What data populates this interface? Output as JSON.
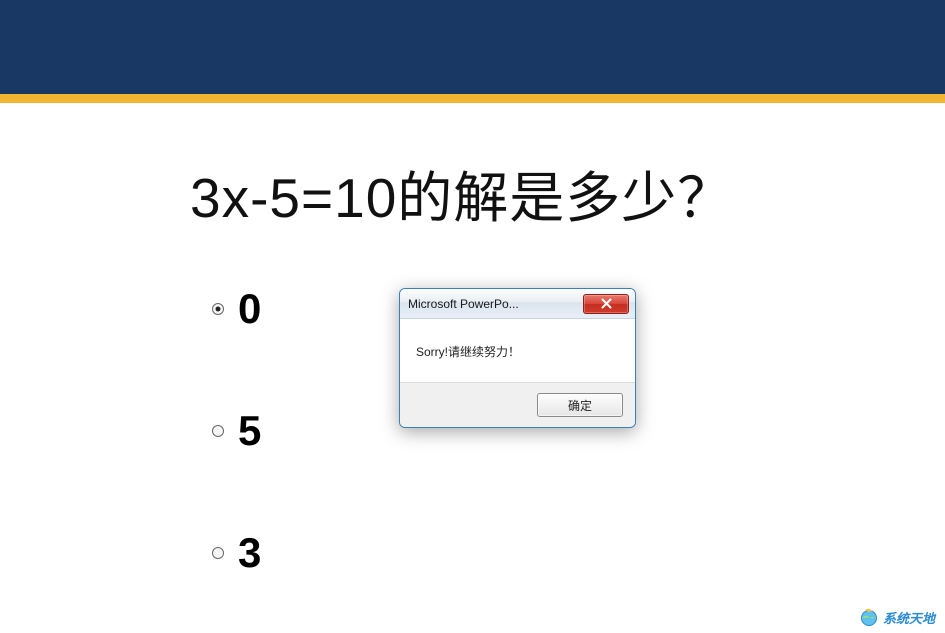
{
  "slide": {
    "question": "3x-5=10的解是多少？",
    "options": [
      {
        "label": "0",
        "selected": true
      },
      {
        "label": "5",
        "selected": false
      },
      {
        "label": "3",
        "selected": false
      }
    ]
  },
  "dialog": {
    "title": "Microsoft PowerPo...",
    "message": "Sorry!请继续努力！",
    "ok_label": "确定"
  },
  "watermark": {
    "text": "系统天地"
  },
  "colors": {
    "header": "#1a3864",
    "accent": "#f2b431",
    "close_btn": "#c62e1f",
    "brand": "#2a8bd4"
  }
}
